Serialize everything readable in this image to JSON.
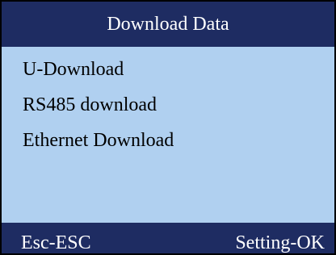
{
  "header": {
    "title": "Download Data"
  },
  "menu": {
    "items": [
      {
        "label": "U-Download"
      },
      {
        "label": "RS485 download"
      },
      {
        "label": "Ethernet Download"
      }
    ]
  },
  "footer": {
    "left_key": "Esc-ESC",
    "right_key": "Setting-OK"
  },
  "colors": {
    "bar_background": "#1e2c62",
    "screen_background": "#b0d0f0",
    "bar_text": "#ffffff",
    "menu_text": "#000000"
  }
}
